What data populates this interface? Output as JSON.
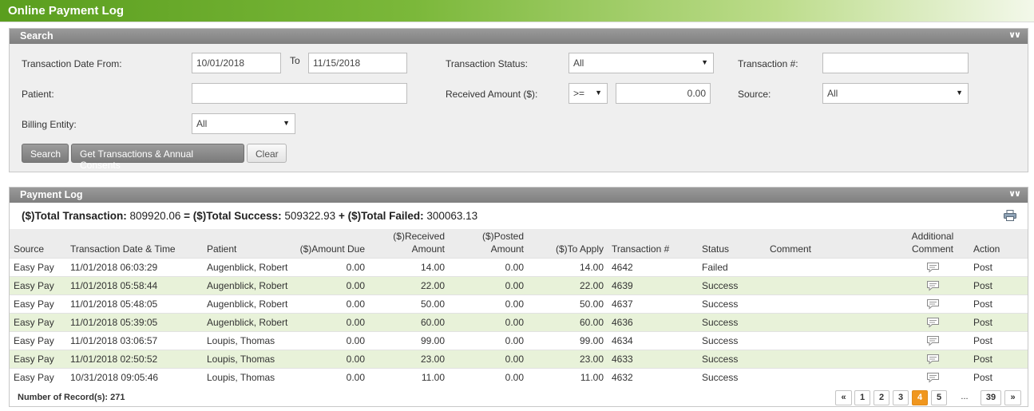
{
  "page": {
    "title": "Online Payment Log"
  },
  "search": {
    "title": "Search",
    "date_from_label": "Transaction Date From:",
    "date_from_value": "10/01/2018",
    "to_label": "To",
    "date_to_value": "11/15/2018",
    "status_label": "Transaction Status:",
    "status_value": "All",
    "txn_label": "Transaction #:",
    "txn_value": "",
    "patient_label": "Patient:",
    "patient_value": "",
    "received_label": "Received Amount ($):",
    "operator_value": ">=",
    "amount_value": "0.00",
    "source_label": "Source:",
    "source_value": "All",
    "billing_label": "Billing Entity:",
    "billing_value": "All",
    "btn_search": "Search",
    "btn_get": "Get Transactions & Annual Consents",
    "btn_clear": "Clear"
  },
  "log": {
    "title": "Payment Log",
    "summary": {
      "total_label": "($)Total Transaction:",
      "total_value": "809920.06",
      "eq": "=",
      "success_label": "($)Total Success:",
      "success_value": "509322.93",
      "plus": "+",
      "failed_label": "($)Total Failed:",
      "failed_value": "300063.13"
    },
    "columns": {
      "source": "Source",
      "datetime": "Transaction Date & Time",
      "patient": "Patient",
      "amount_due": "($)Amount Due",
      "received_1": "($)Received",
      "received_2": "Amount",
      "posted_1": "($)Posted",
      "posted_2": "Amount",
      "to_apply": "($)To Apply",
      "txn": "Transaction #",
      "status": "Status",
      "comment": "Comment",
      "addl_1": "Additional",
      "addl_2": "Comment",
      "action": "Action"
    },
    "rows": [
      {
        "source": "Easy Pay",
        "datetime": "11/01/2018 06:03:29",
        "patient": "Augenblick, Robert",
        "due": "0.00",
        "received": "14.00",
        "posted": "0.00",
        "apply": "14.00",
        "txn": "4642",
        "status": "Failed",
        "comment": "",
        "action": "Post"
      },
      {
        "source": "Easy Pay",
        "datetime": "11/01/2018 05:58:44",
        "patient": "Augenblick, Robert",
        "due": "0.00",
        "received": "22.00",
        "posted": "0.00",
        "apply": "22.00",
        "txn": "4639",
        "status": "Success",
        "comment": "",
        "action": "Post"
      },
      {
        "source": "Easy Pay",
        "datetime": "11/01/2018 05:48:05",
        "patient": "Augenblick, Robert",
        "due": "0.00",
        "received": "50.00",
        "posted": "0.00",
        "apply": "50.00",
        "txn": "4637",
        "status": "Success",
        "comment": "",
        "action": "Post"
      },
      {
        "source": "Easy Pay",
        "datetime": "11/01/2018 05:39:05",
        "patient": "Augenblick, Robert",
        "due": "0.00",
        "received": "60.00",
        "posted": "0.00",
        "apply": "60.00",
        "txn": "4636",
        "status": "Success",
        "comment": "",
        "action": "Post"
      },
      {
        "source": "Easy Pay",
        "datetime": "11/01/2018 03:06:57",
        "patient": "Loupis, Thomas",
        "due": "0.00",
        "received": "99.00",
        "posted": "0.00",
        "apply": "99.00",
        "txn": "4634",
        "status": "Success",
        "comment": "",
        "action": "Post"
      },
      {
        "source": "Easy Pay",
        "datetime": "11/01/2018 02:50:52",
        "patient": "Loupis, Thomas",
        "due": "0.00",
        "received": "23.00",
        "posted": "0.00",
        "apply": "23.00",
        "txn": "4633",
        "status": "Success",
        "comment": "",
        "action": "Post"
      },
      {
        "source": "Easy Pay",
        "datetime": "10/31/2018 09:05:46",
        "patient": "Loupis, Thomas",
        "due": "0.00",
        "received": "11.00",
        "posted": "0.00",
        "apply": "11.00",
        "txn": "4632",
        "status": "Success",
        "comment": "",
        "action": "Post"
      }
    ],
    "records_label": "Number of Record(s): 271",
    "pagination": {
      "first": "«",
      "pages": [
        "1",
        "2",
        "3",
        "4",
        "5"
      ],
      "current": "4",
      "ellipsis": "...",
      "last_page": "39",
      "next": "»"
    }
  },
  "icons": {
    "collapse": "chevrons-down-icon",
    "print": "printer-icon",
    "comment": "speech-bubble-icon",
    "dropdown": "caret-down-icon"
  },
  "colors": {
    "title_green": "#5a9e1e",
    "alt_row": "#e8f2d9",
    "active_page": "#f0961e",
    "panel_header": "#8a8a8a"
  }
}
